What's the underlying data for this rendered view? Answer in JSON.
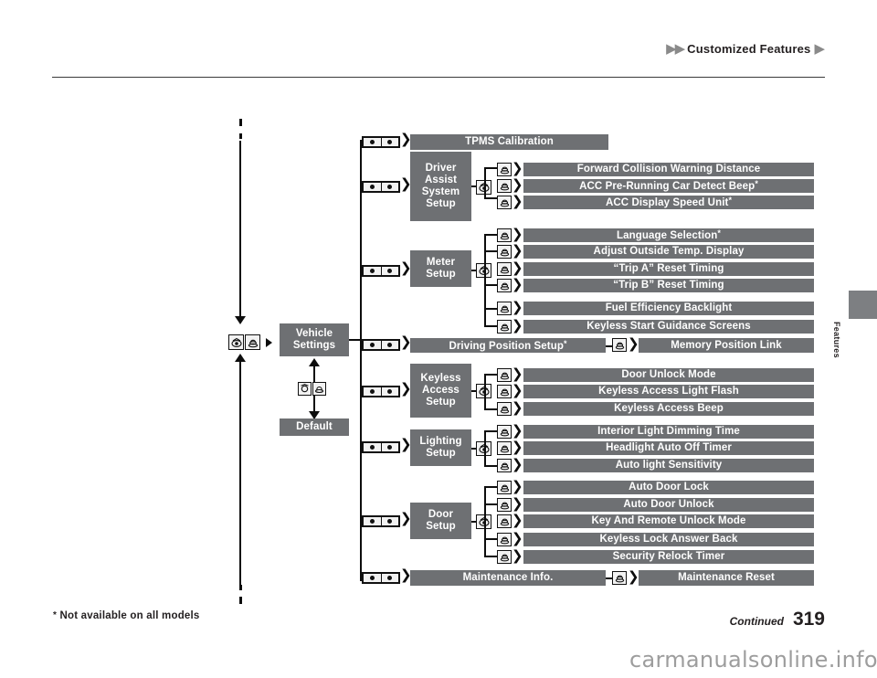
{
  "header": {
    "arrows_left": "▶▶",
    "title": "Customized Features",
    "arrow_right": "▶"
  },
  "side_tab": {
    "label": "Features"
  },
  "footer": {
    "asterisk": "*",
    "footnote": " Not available on all models",
    "continued": "Continued",
    "page_number": "319",
    "watermark": "carmanualsonline.info"
  },
  "colors": {
    "bar_fill": "#6e7073",
    "bar_text": "#ffffff",
    "line": "#0d0d0d",
    "header_accent": "#8a8a8a",
    "side_tab": "#7d7f82",
    "watermark": "#9d9d9d"
  },
  "diagram": {
    "root": {
      "label": "Vehicle\nSettings",
      "line1": "Vehicle",
      "line2": "Settings"
    },
    "default_node": {
      "label": "Default"
    },
    "icons": {
      "rocker": "rocker-selector-icon",
      "dial": "dial-knob-icon",
      "enter": "enter-button-icon",
      "left_right_pair": "left-right-button-pair-icon"
    },
    "groups": [
      {
        "id": "tpms",
        "parent": "TPMS Calibration",
        "parent_asterisk": false,
        "children": []
      },
      {
        "id": "driver-assist-system-setup",
        "parent": "Driver Assist System Setup",
        "parent_lines": [
          "Driver",
          "Assist",
          "System",
          "Setup"
        ],
        "children": [
          {
            "label": "Forward Collision Warning Distance",
            "asterisk": false
          },
          {
            "label": "ACC Pre-Running Car Detect Beep",
            "asterisk": true
          },
          {
            "label": "ACC Display Speed Unit",
            "asterisk": true
          }
        ]
      },
      {
        "id": "meter-setup",
        "parent": "Meter Setup",
        "parent_lines": [
          "Meter",
          "Setup"
        ],
        "children": [
          {
            "label": "Language Selection",
            "asterisk": true
          },
          {
            "label": "Adjust Outside Temp. Display",
            "asterisk": false
          },
          {
            "label": "“Trip A” Reset Timing",
            "asterisk": false
          },
          {
            "label": "“Trip B” Reset Timing",
            "asterisk": false
          },
          {
            "label": "Fuel Efficiency Backlight",
            "asterisk": false
          },
          {
            "label": "Keyless Start Guidance Screens",
            "asterisk": false
          }
        ]
      },
      {
        "id": "driving-position-setup",
        "parent": "Driving Position Setup",
        "parent_asterisk": true,
        "children": [
          {
            "label": "Memory Position Link",
            "asterisk": false
          }
        ]
      },
      {
        "id": "keyless-access-setup",
        "parent": "Keyless Access Setup",
        "parent_lines": [
          "Keyless",
          "Access",
          "Setup"
        ],
        "children": [
          {
            "label": "Door Unlock Mode",
            "asterisk": false
          },
          {
            "label": "Keyless Access Light Flash",
            "asterisk": false
          },
          {
            "label": "Keyless Access Beep",
            "asterisk": false
          }
        ]
      },
      {
        "id": "lighting-setup",
        "parent": "Lighting Setup",
        "parent_lines": [
          "Lighting",
          "Setup"
        ],
        "children": [
          {
            "label": "Interior Light Dimming Time",
            "asterisk": false
          },
          {
            "label": "Headlight Auto Off Timer",
            "asterisk": false
          },
          {
            "label": "Auto light Sensitivity",
            "asterisk": false
          }
        ]
      },
      {
        "id": "door-setup",
        "parent": "Door Setup",
        "parent_lines": [
          "Door",
          "Setup"
        ],
        "children": [
          {
            "label": "Auto Door Lock",
            "asterisk": false
          },
          {
            "label": "Auto Door Unlock",
            "asterisk": false
          },
          {
            "label": "Key And Remote Unlock Mode",
            "asterisk": false
          },
          {
            "label": "Keyless Lock Answer Back",
            "asterisk": false
          },
          {
            "label": "Security Relock Timer",
            "asterisk": false
          }
        ]
      },
      {
        "id": "maintenance-info",
        "parent": "Maintenance Info.",
        "parent_asterisk": false,
        "children": [
          {
            "label": "Maintenance Reset",
            "asterisk": false
          }
        ]
      }
    ]
  }
}
